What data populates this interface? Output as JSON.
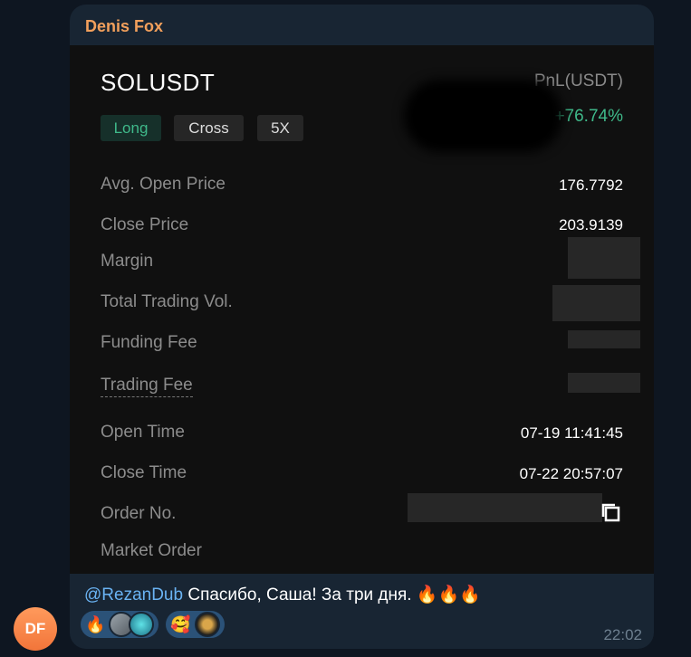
{
  "chat": {
    "avatar_initials": "DF",
    "sender_name": "Denis Fox",
    "time": "22:02",
    "caption_mention": "@RezanDub",
    "caption_text": " Спасибо, Саша! За три дня. 🔥🔥🔥"
  },
  "trade_card": {
    "symbol": "SOLUSDT",
    "pnl_label": "PnL(USDT)",
    "pnl_value": "+76.74%",
    "tags": {
      "side": "Long",
      "margin_mode": "Cross",
      "leverage": "5X"
    },
    "rows": {
      "avg_open_price": {
        "label": "Avg. Open Price",
        "value": "176.7792"
      },
      "close_price": {
        "label": "Close Price",
        "value": "203.9139"
      },
      "margin": {
        "label": "Margin"
      },
      "total_trading_vol": {
        "label": "Total Trading Vol."
      },
      "funding_fee": {
        "label": "Funding Fee"
      },
      "trading_fee": {
        "label": "Trading Fee"
      },
      "open_time": {
        "label": "Open Time",
        "value": "07-19 11:41:45"
      },
      "close_time": {
        "label": "Close Time",
        "value": "07-22 20:57:07"
      },
      "order_no": {
        "label": "Order No."
      },
      "market_order": {
        "label": "Market Order"
      }
    }
  },
  "reactions": [
    {
      "emoji": "🔥"
    },
    {
      "emoji": "🥰"
    }
  ],
  "colors": {
    "background": "#0e1621",
    "bubble": "#182533",
    "card": "#101010",
    "sender": "#f2a05c",
    "profit": "#3fb98a",
    "mention": "#6ab3f3",
    "reaction": "#2b5278"
  }
}
